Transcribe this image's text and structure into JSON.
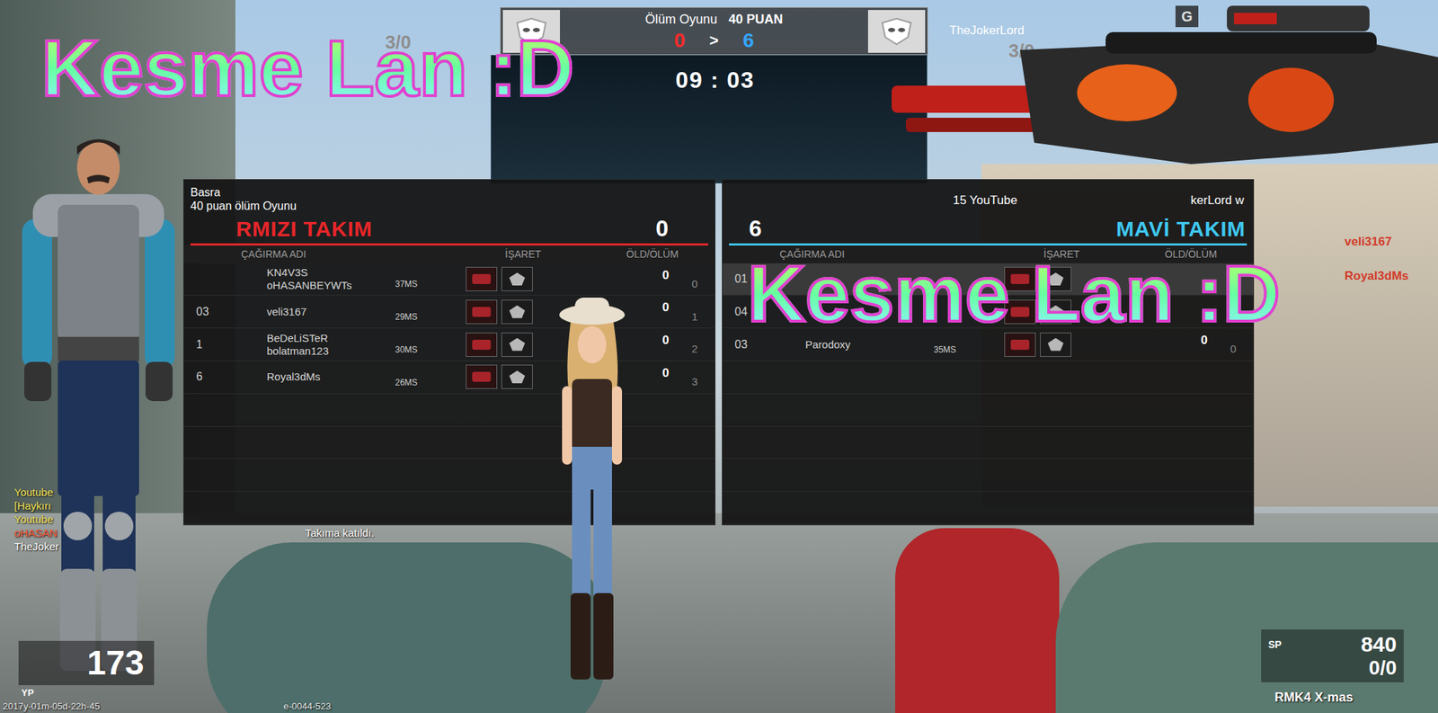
{
  "hud": {
    "mode": "Ölüm Oyunu",
    "target": "40 PUAN",
    "red_score": "0",
    "separator": ">",
    "blue_score": "6",
    "timer": "09 : 03",
    "my_score": "3/0",
    "top_player": "TheJokerLord",
    "top_player_score": "3/0",
    "corner_key": "G"
  },
  "overlay_titles": [
    "Kesme Lan :D",
    "Kesme Lan :D"
  ],
  "scoreboard": {
    "map": "Basra",
    "mode": "40 puan ölüm Oyunu",
    "room_title_start": "15 YouTube",
    "room_title_end": "kerLord w",
    "columns": [
      "ÇAĞIRMA ADI",
      "İŞARET",
      "ÖLD/ÖLÜM"
    ],
    "teams": [
      {
        "name": "RMIZI TAKIM",
        "score": "0",
        "color": "#e8262a",
        "rows": [
          {
            "name": "KN4V3S",
            "name2": "oHASANBEYWTs",
            "ping": "37MS",
            "kills": "0",
            "deaths": "0",
            "highlighted": false
          },
          {
            "rank": "03",
            "name": "veli3167",
            "ping": "29MS",
            "kills": "0",
            "deaths": "1",
            "highlighted": false
          },
          {
            "rank": "1",
            "name": "BeDeLiSTeR",
            "name2": "bolatman123",
            "ping": "30MS",
            "kills": "0",
            "deaths": "2",
            "highlighted": false
          },
          {
            "rank": "6",
            "name": "Royal3dMs",
            "ping": "26MS",
            "kills": "0",
            "deaths": "3",
            "highlighted": false
          }
        ]
      },
      {
        "name": "MAVİ TAKIM",
        "score": "6",
        "color": "#3fc8f0",
        "rows": [
          {
            "rank": "01",
            "highlighted": true
          },
          {
            "rank": "04",
            "highlighted": false
          },
          {
            "rank": "03",
            "name": "Parodoxy",
            "ping": "35MS",
            "kills": "0",
            "deaths": "0",
            "highlighted": false
          }
        ]
      }
    ]
  },
  "kill_feed": [
    "veli3167",
    "Royal3dMs"
  ],
  "chat": [
    {
      "text": "Youtube",
      "color": "#f2e35a"
    },
    {
      "text": "[Haykırı",
      "color": "#f2e35a"
    },
    {
      "text": "Youtube",
      "color": "#f2e35a"
    },
    {
      "text": "oHASAN",
      "tail": "Takıma katıldı.",
      "color": "#ff6040"
    },
    {
      "text": "TheJoker",
      "color": "#ffffff"
    }
  ],
  "status": {
    "hp": "173",
    "hp_label": "YP",
    "sp_label": "SP",
    "sp": "840",
    "ammo": "0/0",
    "weapon": "RMK4 X-mas",
    "timestamp": [
      "2017y-01m-05d-22h-45",
      "e-0044-523"
    ]
  }
}
